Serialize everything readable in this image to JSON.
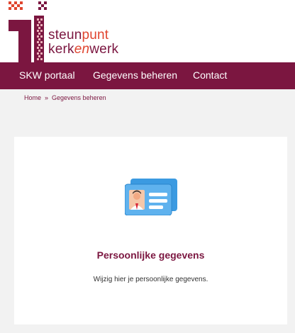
{
  "brand": {
    "line1_main": "steun",
    "line1_accent": "punt",
    "line2_main_a": "kerk",
    "line2_accent": "en",
    "line2_main_b": "werk"
  },
  "nav": {
    "items": [
      {
        "label": "SKW portaal"
      },
      {
        "label": "Gegevens beheren"
      },
      {
        "label": "Contact"
      }
    ]
  },
  "breadcrumb": {
    "home": "Home",
    "separator": "»",
    "current": "Gegevens beheren"
  },
  "card": {
    "icon": "id-card-icon",
    "title": "Persoonlijke gegevens",
    "description": "Wijzig hier je persoonlijke gegevens."
  },
  "colors": {
    "brand": "#7b1640",
    "accent": "#e0452f",
    "icon_blue": "#3b9ae1",
    "background": "#f2f2f2"
  }
}
